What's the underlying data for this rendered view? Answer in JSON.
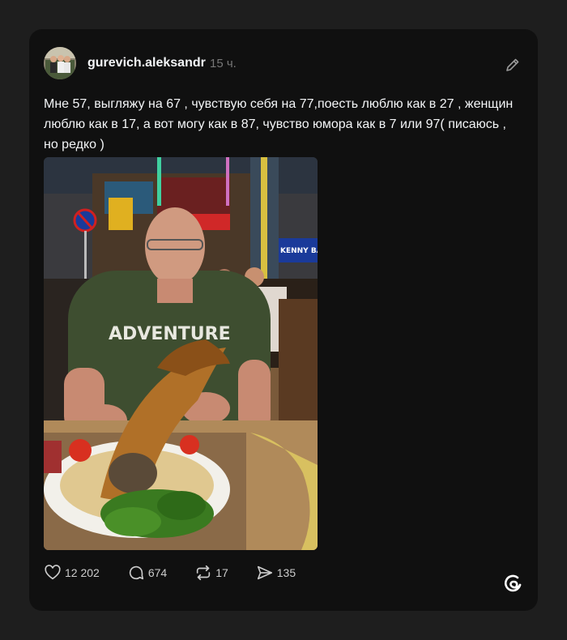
{
  "post": {
    "username": "gurevich.aleksandr",
    "time": "15 ч.",
    "text": "Мне 57, выгляжу на 67 , чувствую себя на 77,поесть люблю как в 27 , женщин люблю как в 17, а вот могу как в 87, чувство юмора как в 7 или 97( писаюсь , но редко )",
    "shirt_text": "ADVENTURE",
    "sign_text": "KENNY BAR"
  },
  "actions": {
    "likes": "12 202",
    "comments": "674",
    "reposts": "17",
    "shares": "135"
  },
  "icons": {
    "edit": "pencil-icon",
    "like": "heart-icon",
    "comment": "comment-icon",
    "repost": "repost-icon",
    "share": "send-icon",
    "brand": "threads-logo-icon"
  },
  "colors": {
    "background": "#1e1e1e",
    "card": "#101010",
    "text": "#f3f5f7",
    "muted": "#777777"
  }
}
